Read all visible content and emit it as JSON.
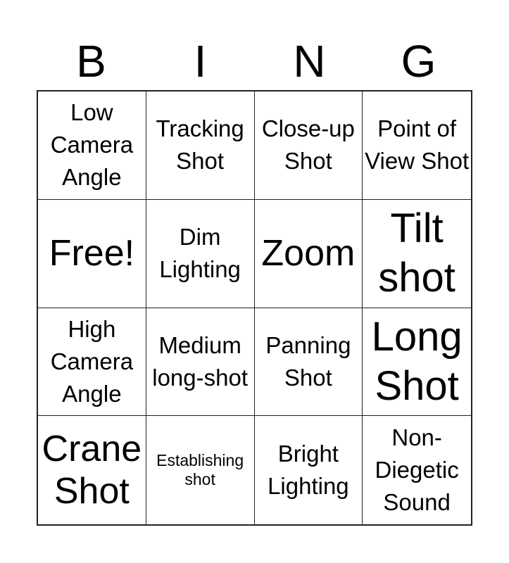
{
  "title_letters": [
    "B",
    "I",
    "N",
    "G"
  ],
  "cells": [
    "Low Camera Angle",
    "Tracking Shot",
    "Close-up Shot",
    "Point of View Shot",
    "Free!",
    "Dim Lighting",
    "Zoom",
    "Tilt shot",
    "High Camera Angle",
    "Medium long-shot",
    "Panning Shot",
    "Long Shot",
    "Crane Shot",
    "Establishing shot",
    "Bright Lighting",
    "Non-Diegetic Sound"
  ]
}
